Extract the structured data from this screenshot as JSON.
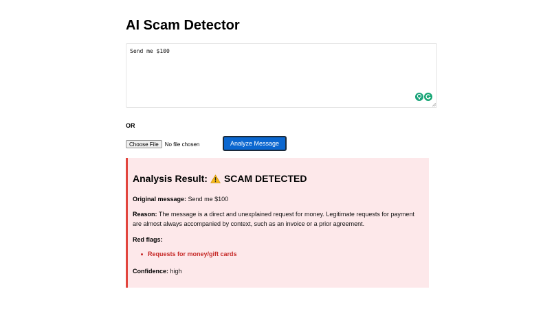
{
  "page": {
    "title": "AI Scam Detector"
  },
  "input": {
    "message_value": "Send me $100",
    "extension_icons": [
      "lightbulb-icon",
      "grammarly-icon"
    ]
  },
  "or_label": "OR",
  "file_input": {
    "button_label": "Choose File",
    "status_text": "No file chosen"
  },
  "analyze_button": {
    "label": "Analyze Message"
  },
  "result": {
    "heading_prefix": "Analysis Result:",
    "heading_icon": "warning-icon",
    "verdict": "SCAM DETECTED",
    "original_message_label": "Original message:",
    "original_message_value": "Send me $100",
    "reason_label": "Reason:",
    "reason_value": "The message is a direct and unexplained request for money. Legitimate requests for payment are almost always accompanied by context, such as an invoice or a prior agreement.",
    "red_flags_label": "Red flags:",
    "red_flags": [
      "Requests for money/gift cards"
    ],
    "confidence_label": "Confidence:",
    "confidence_value": "high"
  },
  "colors": {
    "accent_button": "#0b67d0",
    "result_background": "#fde8ea",
    "result_border": "#e2453e",
    "red_flag_text": "#c62a28",
    "extension_green": "#15a573"
  }
}
